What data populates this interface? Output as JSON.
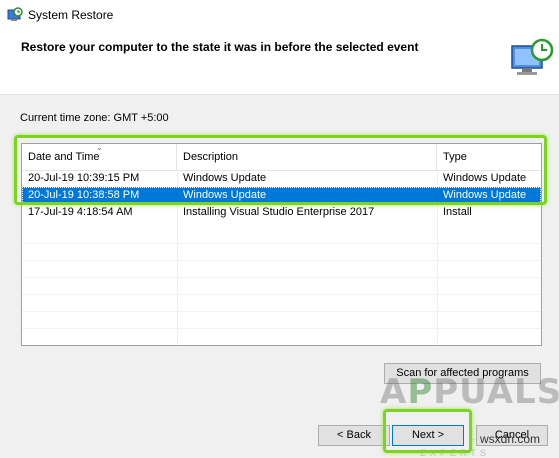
{
  "window": {
    "title": "System Restore"
  },
  "header": {
    "heading": "Restore your computer to the state it was in before the selected event"
  },
  "timezone": {
    "label": "Current time zone: GMT +5:00"
  },
  "list": {
    "columns": [
      "Date and Time",
      "Description",
      "Type"
    ],
    "rows": [
      {
        "date": "20-Jul-19 10:39:15 PM",
        "description": "Windows Update",
        "type": "Windows Update",
        "selected": false
      },
      {
        "date": "20-Jul-19 10:38:58 PM",
        "description": "Windows Update",
        "type": "Windows Update",
        "selected": true
      },
      {
        "date": "17-Jul-19 4:18:54 AM",
        "description": "Installing Visual Studio Enterprise 2017",
        "type": "Install",
        "selected": false
      }
    ]
  },
  "buttons": {
    "scan": "Scan for affected programs",
    "back": "< Back",
    "next": "Next >",
    "cancel": "Cancel"
  },
  "colors": {
    "selection": "#0078d7",
    "highlight": "#7dd321"
  },
  "watermark": {
    "logo": "APPUALS",
    "sub": "FROM THE EXPERTS",
    "site": "wsxdn.com"
  }
}
